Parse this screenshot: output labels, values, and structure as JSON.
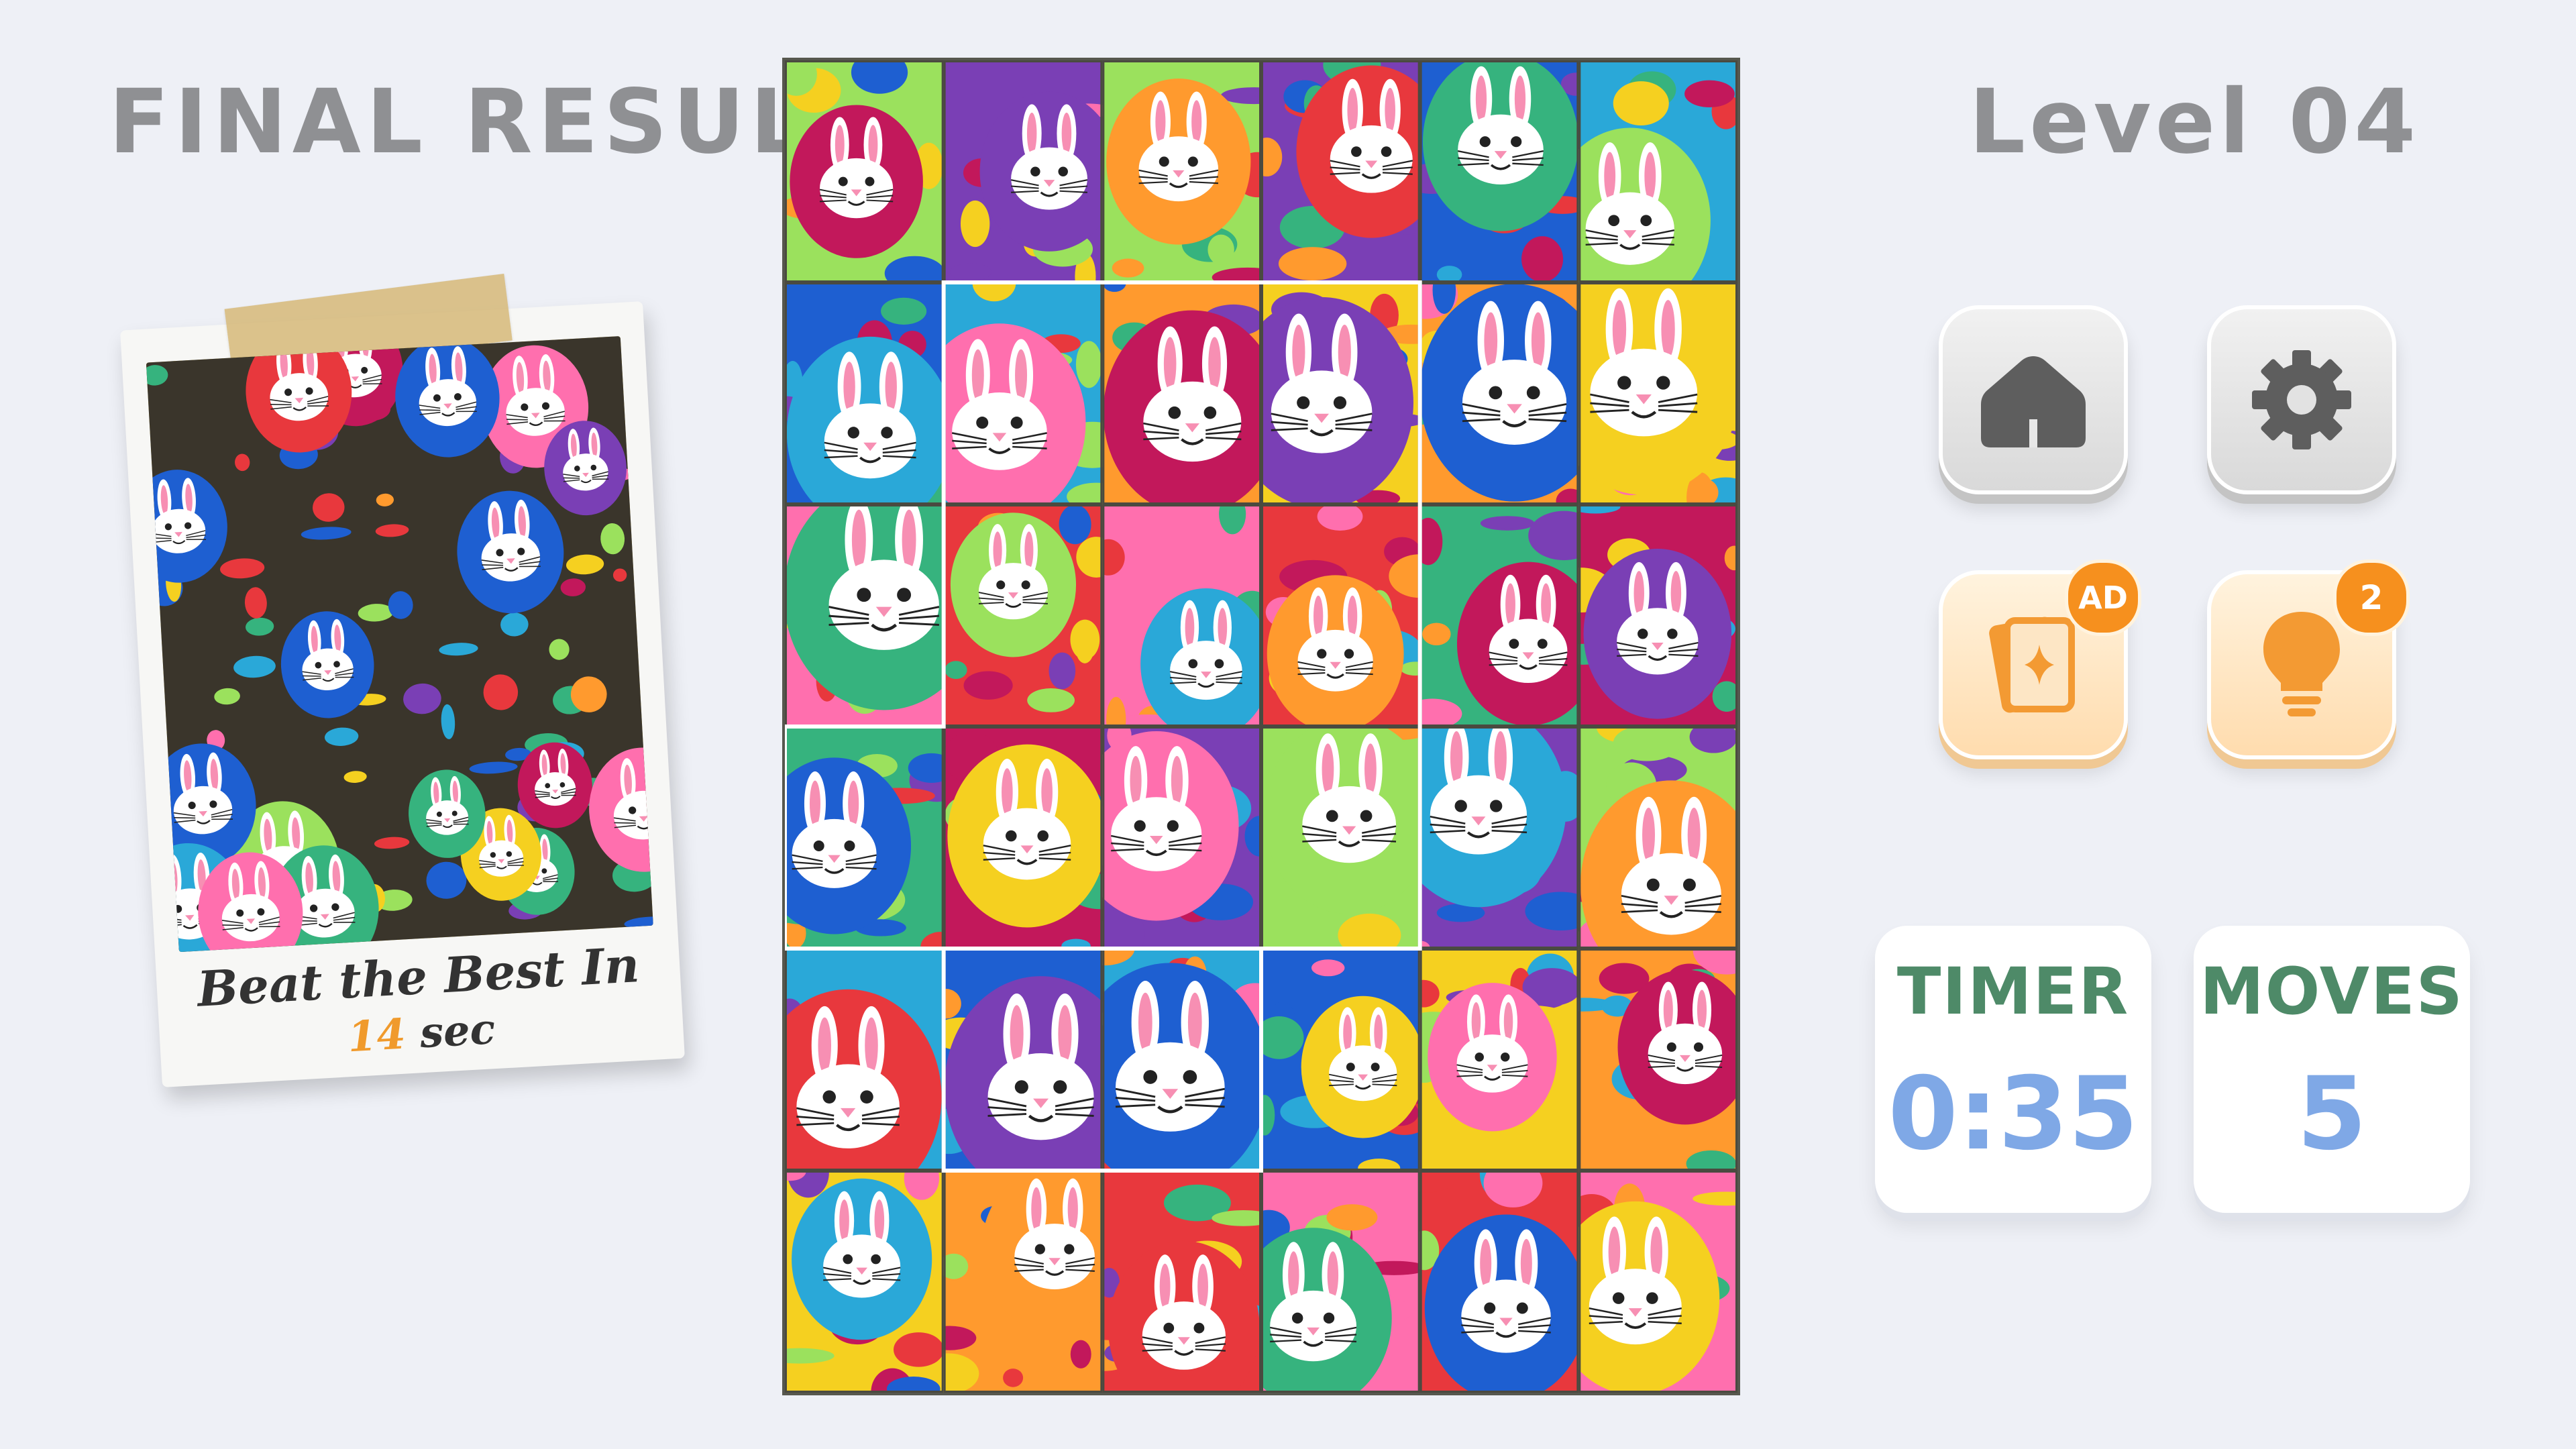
{
  "header": {
    "final_result": "FINAL RESULT",
    "level": "Level 04"
  },
  "preview": {
    "caption_line1": "Beat the Best In",
    "caption_number": "14",
    "caption_unit": "sec"
  },
  "buttons": {
    "home_icon": "home-icon",
    "settings_icon": "gear-icon",
    "cards_icon": "cards-sparkle-icon",
    "cards_badge": "AD",
    "hint_icon": "lightbulb-icon",
    "hint_badge": "2"
  },
  "stats": {
    "timer_label": "TIMER",
    "timer_value": "0:35",
    "moves_label": "MOVES",
    "moves_value": "5"
  },
  "colors": {
    "title_gray": "#8f9093",
    "label_green": "#4e8a68",
    "value_blue": "#7fa8e6",
    "accent_orange": "#f6901e"
  }
}
